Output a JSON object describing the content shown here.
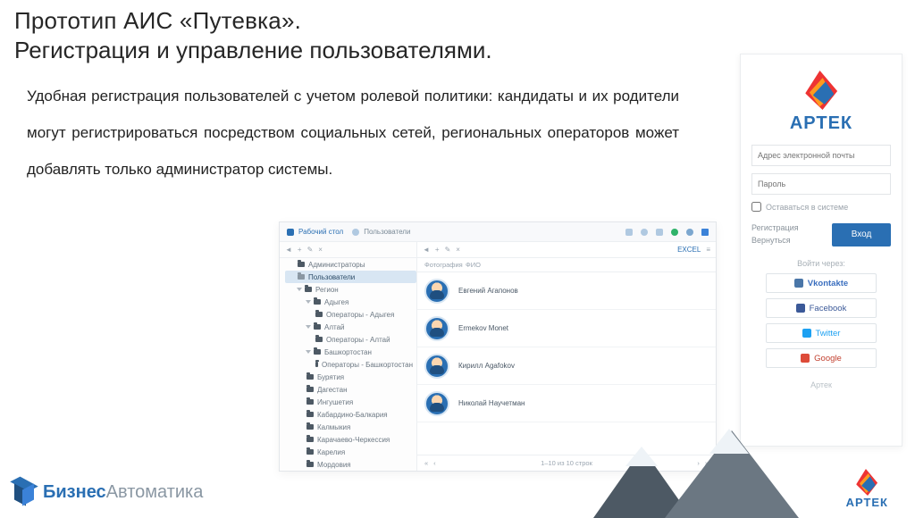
{
  "title1": "Прототип АИС «Путевка».",
  "title2": "Регистрация и управление пользователями.",
  "body": "Удобная регистрация пользователей с учетом ролевой политики: кандидаты и их родители могут регистрироваться посредством социальных сетей, региональных операторов может добавлять только администратор системы.",
  "brand": {
    "strong": "Бизнес",
    "light": "Автоматика"
  },
  "footer_logo": "АРТЕК",
  "admin": {
    "crumbs": {
      "home": "Рабочий стол",
      "users": "Пользователи"
    },
    "toolbar": {
      "b1": "◄",
      "b2": "+",
      "b3": "✎",
      "b4": "×"
    },
    "tree": [
      {
        "label": "Администраторы",
        "indent": 1,
        "sel": false,
        "caret": ""
      },
      {
        "label": "Пользователи",
        "indent": 1,
        "sel": true,
        "caret": ""
      },
      {
        "label": "Регион",
        "indent": 1,
        "sel": false,
        "caret": "open"
      },
      {
        "label": "Адыгея",
        "indent": 2,
        "sel": false,
        "caret": "open"
      },
      {
        "label": "Операторы - Адыгея",
        "indent": 3,
        "sel": false,
        "caret": ""
      },
      {
        "label": "Алтай",
        "indent": 2,
        "sel": false,
        "caret": "open"
      },
      {
        "label": "Операторы - Алтай",
        "indent": 3,
        "sel": false,
        "caret": ""
      },
      {
        "label": "Башкортостан",
        "indent": 2,
        "sel": false,
        "caret": "open"
      },
      {
        "label": "Операторы - Башкортостан",
        "indent": 3,
        "sel": false,
        "caret": ""
      },
      {
        "label": "Бурятия",
        "indent": 2,
        "sel": false,
        "caret": ""
      },
      {
        "label": "Дагестан",
        "indent": 2,
        "sel": false,
        "caret": ""
      },
      {
        "label": "Ингушетия",
        "indent": 2,
        "sel": false,
        "caret": ""
      },
      {
        "label": "Кабардино-Балкария",
        "indent": 2,
        "sel": false,
        "caret": ""
      },
      {
        "label": "Калмыкия",
        "indent": 2,
        "sel": false,
        "caret": ""
      },
      {
        "label": "Карачаево-Черкессия",
        "indent": 2,
        "sel": false,
        "caret": ""
      },
      {
        "label": "Карелия",
        "indent": 2,
        "sel": false,
        "caret": ""
      },
      {
        "label": "Мордовия",
        "indent": 2,
        "sel": false,
        "caret": ""
      }
    ],
    "list": {
      "head": {
        "photo": "Фотография",
        "name": "ФИО"
      },
      "excel": "EXCEL",
      "rows": [
        {
          "name": "Евгений Агапонов"
        },
        {
          "name": "Ermekov Monet"
        },
        {
          "name": "Кирилл Agafokov"
        },
        {
          "name": "Николай Научетман"
        }
      ],
      "pager": "1–10 из 10 строк"
    }
  },
  "login": {
    "brand": "АРТЕК",
    "email_ph": "Адрес электронной почты",
    "pass_ph": "Пароль",
    "remember": "Оставаться в системе",
    "register": "Регистрация",
    "back": "Вернуться",
    "login_btn": "Вход",
    "via": "Войти через:",
    "social": {
      "vk": "Vkontakte",
      "fb": "Facebook",
      "tw": "Twitter",
      "gg": "Google"
    },
    "footer": "Артек"
  }
}
